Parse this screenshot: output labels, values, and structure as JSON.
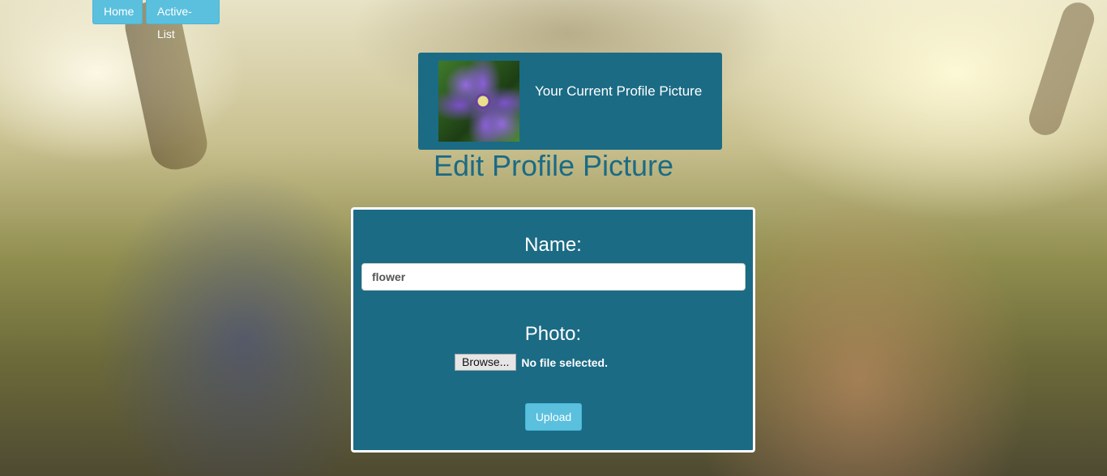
{
  "nav": {
    "home_label": "Home",
    "active_list_label": "Active-List"
  },
  "current_picture": {
    "label": "Your Current Profile Picture"
  },
  "page": {
    "title": "Edit Profile Picture"
  },
  "form": {
    "name_label": "Name:",
    "name_value": "flower",
    "photo_label": "Photo:",
    "browse_label": "Browse...",
    "file_status": "No file selected.",
    "upload_label": "Upload"
  },
  "colors": {
    "panel": "#1b6b85",
    "button": "#5bc0de",
    "title": "#1b6b85"
  }
}
